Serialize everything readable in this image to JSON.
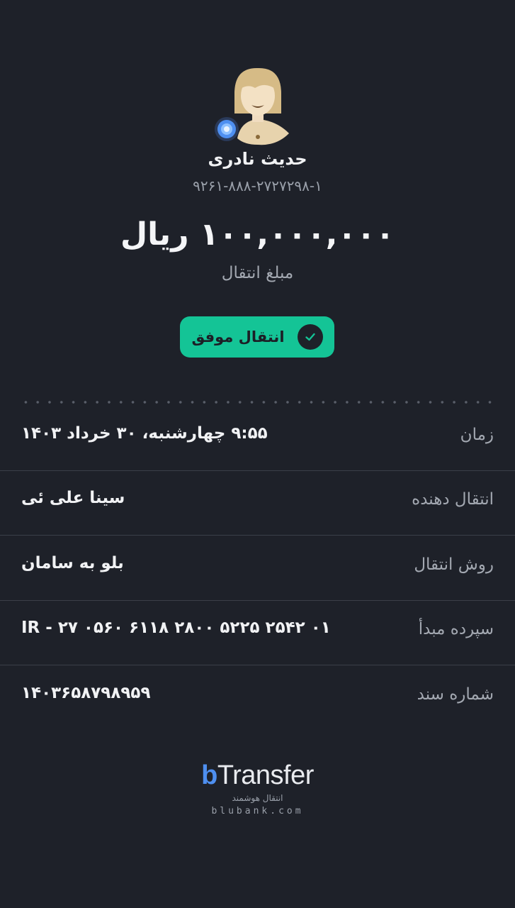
{
  "recipient": {
    "name": "حدیث نادری",
    "account": "۹۲۶۱-۸۸۸-۲۷۲۷۲۹۸-۱"
  },
  "transfer": {
    "amount": "۱۰۰,۰۰۰,۰۰۰ ریال",
    "amount_label": "مبلغ انتقال",
    "status": "انتقال موفق"
  },
  "details": [
    {
      "label": "زمان",
      "value": "۹:۵۵ چهارشنبه، ۳۰ خرداد ۱۴۰۳"
    },
    {
      "label": "انتقال دهنده",
      "value": "سینا علی ئی"
    },
    {
      "label": "روش انتقال",
      "value": "بلو به سامان"
    },
    {
      "label": "سپرده مبدأ",
      "value": "IR - ۲۷ ۰۵۶۰ ۶۱۱۸ ۲۸۰۰ ۵۲۲۵ ۲۵۴۲ ۰۱"
    },
    {
      "label": "شماره سند",
      "value": "۱۴۰۳۶۵۸۷۹۸۹۵۹"
    }
  ],
  "brand": {
    "logo_b": "b",
    "logo_rest": "Transfer",
    "tagline": "انتقال هوشمند",
    "url": "blubank.com"
  },
  "colors": {
    "background": "#1e2129",
    "success": "#14c496",
    "accent": "#4e8ff0"
  }
}
